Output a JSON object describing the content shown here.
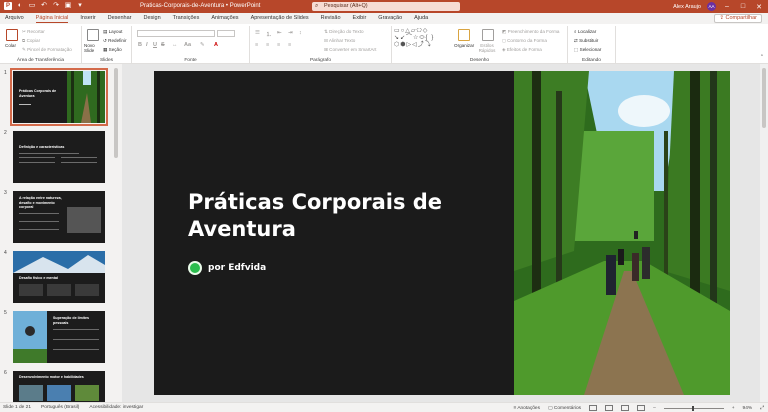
{
  "titlebar": {
    "doc_title": "Praticas-Corporais-de-Aventura  •  PowerPoint",
    "search_placeholder": "Pesquisar (Alt+Q)",
    "user_name": "Alex Araujo",
    "user_initials": "AA"
  },
  "menu": {
    "tabs": [
      "Arquivo",
      "Página Inicial",
      "Inserir",
      "Desenhar",
      "Design",
      "Transições",
      "Animações",
      "Apresentação de Slides",
      "Revisão",
      "Exibir",
      "Gravação",
      "Ajuda"
    ],
    "active": "Página Inicial",
    "share_label": "Compartilhar"
  },
  "ribbon": {
    "clipboard": {
      "label": "Área de Transferência",
      "paste": "Colar",
      "cut": "Recortar",
      "copy": "Copiar",
      "format_painter": "Pincel de Formatação"
    },
    "slides": {
      "label": "Slides",
      "new_slide": "Novo Slide",
      "layout": "Layout",
      "reset": "Redefinir",
      "section": "Seção"
    },
    "font": {
      "label": "Fonte"
    },
    "paragraph": {
      "label": "Parágrafo",
      "text_direction": "Direção do Texto",
      "align_text": "Alinhar Texto",
      "smartart": "Converter em SmartArt"
    },
    "drawing": {
      "label": "Desenho",
      "arrange": "Organizar",
      "quick_styles": "Estilos Rápidos",
      "fill": "Preenchimento da Forma",
      "outline": "Contorno da Forma",
      "effects": "Efeitos de Forma"
    },
    "editing": {
      "label": "Editando",
      "find": "Localizar",
      "replace": "Substituir",
      "select": "Selecionar"
    }
  },
  "thumbnails": [
    {
      "num": "1",
      "title": "Práticas Corporais de Aventura"
    },
    {
      "num": "2",
      "title": "Definição e características"
    },
    {
      "num": "3",
      "title": "A relação entre natureza, desafio e movimento corporal"
    },
    {
      "num": "4",
      "title": "Desafio físico e mental"
    },
    {
      "num": "5",
      "title": "Superação de limites pessoais"
    },
    {
      "num": "6",
      "title": "Desenvolvimento motor e habilidades"
    }
  ],
  "slide": {
    "title_line1": "Práticas Corporais de",
    "title_line2": "Aventura",
    "author": "por Edfvida"
  },
  "status": {
    "slide_info": "Slide 1 de 21",
    "language": "Português (Brasil)",
    "accessibility": "Acessibilidade: investigar",
    "notes": "Anotações",
    "comments": "Comentários",
    "zoom": "94%"
  },
  "colors": {
    "accent": "#b7472a",
    "slide_bg": "#1b1b1b",
    "selection": "#d36a4a"
  }
}
